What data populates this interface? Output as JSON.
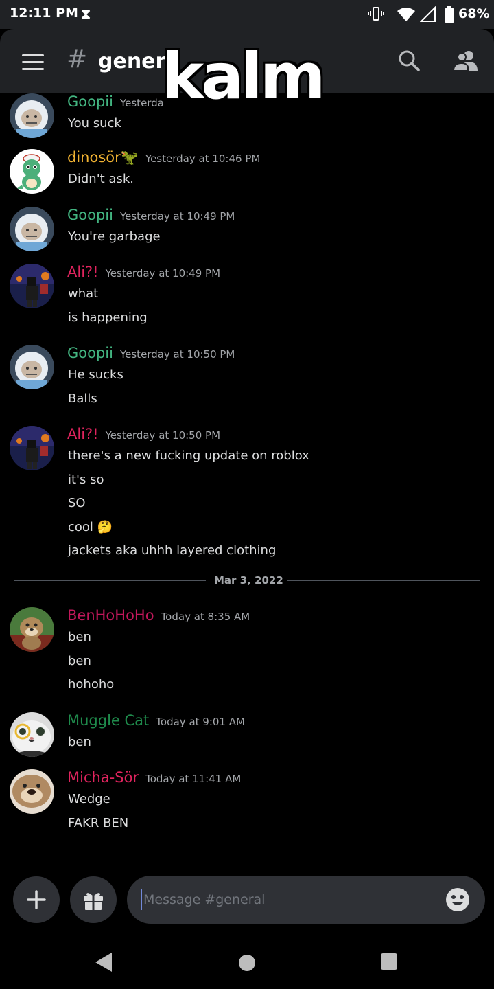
{
  "status_bar": {
    "time": "12:11 PM",
    "alarm_glyph": "⧗",
    "vibrate_glyph": "▯",
    "battery_pct": "68%"
  },
  "header": {
    "channel_prefix": "#",
    "channel_name": "genera",
    "overlay_text": "kalm"
  },
  "messages": [
    {
      "username": "Goopii",
      "timestamp": "Yesterda",
      "color": "#43b581",
      "avatar": "goopii",
      "lines": [
        "You suck"
      ]
    },
    {
      "username": "dinosör🦖",
      "timestamp": "Yesterday at 10:46 PM",
      "color": "#f0b232",
      "avatar": "dino",
      "lines": [
        "Didn't ask."
      ]
    },
    {
      "username": "Goopii",
      "timestamp": "Yesterday at 10:49 PM",
      "color": "#43b581",
      "avatar": "goopii",
      "lines": [
        "You're garbage"
      ]
    },
    {
      "username": "Ali?!",
      "timestamp": "Yesterday at 10:49 PM",
      "color": "#e0245e",
      "avatar": "ali",
      "lines": [
        "what",
        "is happening"
      ]
    },
    {
      "username": "Goopii",
      "timestamp": "Yesterday at 10:50 PM",
      "color": "#43b581",
      "avatar": "goopii",
      "lines": [
        "He sucks",
        "Balls"
      ]
    },
    {
      "username": "Ali?!",
      "timestamp": "Yesterday at 10:50 PM",
      "color": "#e0245e",
      "avatar": "ali",
      "lines": [
        "there's a new fucking update on roblox",
        "it's so",
        "SO",
        "cool 🤔",
        "jackets aka uhhh layered clothing"
      ]
    },
    {
      "username": "BenHoHoHo",
      "timestamp": "Today at 8:35 AM",
      "color": "#c2185b",
      "avatar": "ben",
      "lines": [
        "ben",
        "ben",
        "hohoho"
      ]
    },
    {
      "username": "Muggle Cat",
      "timestamp": "Today at 9:01 AM",
      "color": "#1f8b4c",
      "avatar": "cat",
      "lines": [
        "ben"
      ]
    },
    {
      "username": "Micha-Sör",
      "timestamp": "Today at 11:41 AM",
      "color": "#e0245e",
      "avatar": "micha",
      "lines": [
        "Wedge",
        "FAKR BEN"
      ]
    }
  ],
  "date_divider": "Mar 3, 2022",
  "composer": {
    "placeholder": "Message #general"
  },
  "colors": {
    "background": "#000000",
    "header": "#202225",
    "input": "#2f3136",
    "accent": "#7289da"
  }
}
